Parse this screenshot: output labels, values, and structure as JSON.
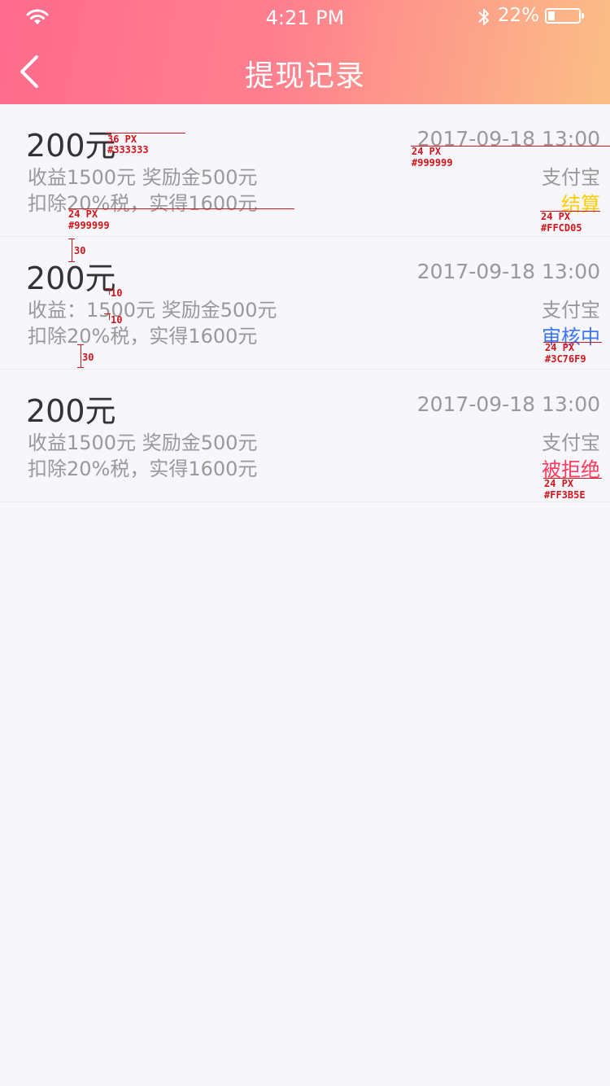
{
  "status_bar": {
    "time": "4:21 PM",
    "battery_percent": "22%"
  },
  "nav": {
    "title": "提现记录",
    "back_icon": "chevron-left-icon"
  },
  "records": [
    {
      "amount": "200元",
      "income": "收益1500元  奖励金500元",
      "tax": "扣除20%税，实得1600元",
      "date": "2017-09-18 13:00",
      "method": "支付宝",
      "status": "结算",
      "status_color": "#FFCD05"
    },
    {
      "amount": "200元",
      "income": "收益：1500元  奖励金500元",
      "tax": "扣除20%税，实得1600元",
      "date": "2017-09-18 13:00",
      "method": "支付宝",
      "status": "审核中",
      "status_color": "#3C76F9"
    },
    {
      "amount": "200元",
      "income": "收益1500元  奖励金500元",
      "tax": "扣除20%税，实得1600元",
      "date": "2017-09-18 13:00",
      "method": "支付宝",
      "status": "被拒绝",
      "status_color": "#FF3B5E"
    }
  ],
  "annotations": {
    "amount_size": "36 PX",
    "amount_color": "#333333",
    "date_size": "24 PX",
    "date_color": "#999999",
    "text_size": "24 PX",
    "text_color": "#999999",
    "status1_size": "24 PX",
    "status1_color": "#FFCD05",
    "status2_size": "24 PX",
    "status2_color": "#3C76F9",
    "status3_size": "24 PX",
    "status3_color": "#FF3B5E",
    "gap_top": "30",
    "gap_line1": "10",
    "gap_line2": "10",
    "gap_bottom": "30"
  }
}
